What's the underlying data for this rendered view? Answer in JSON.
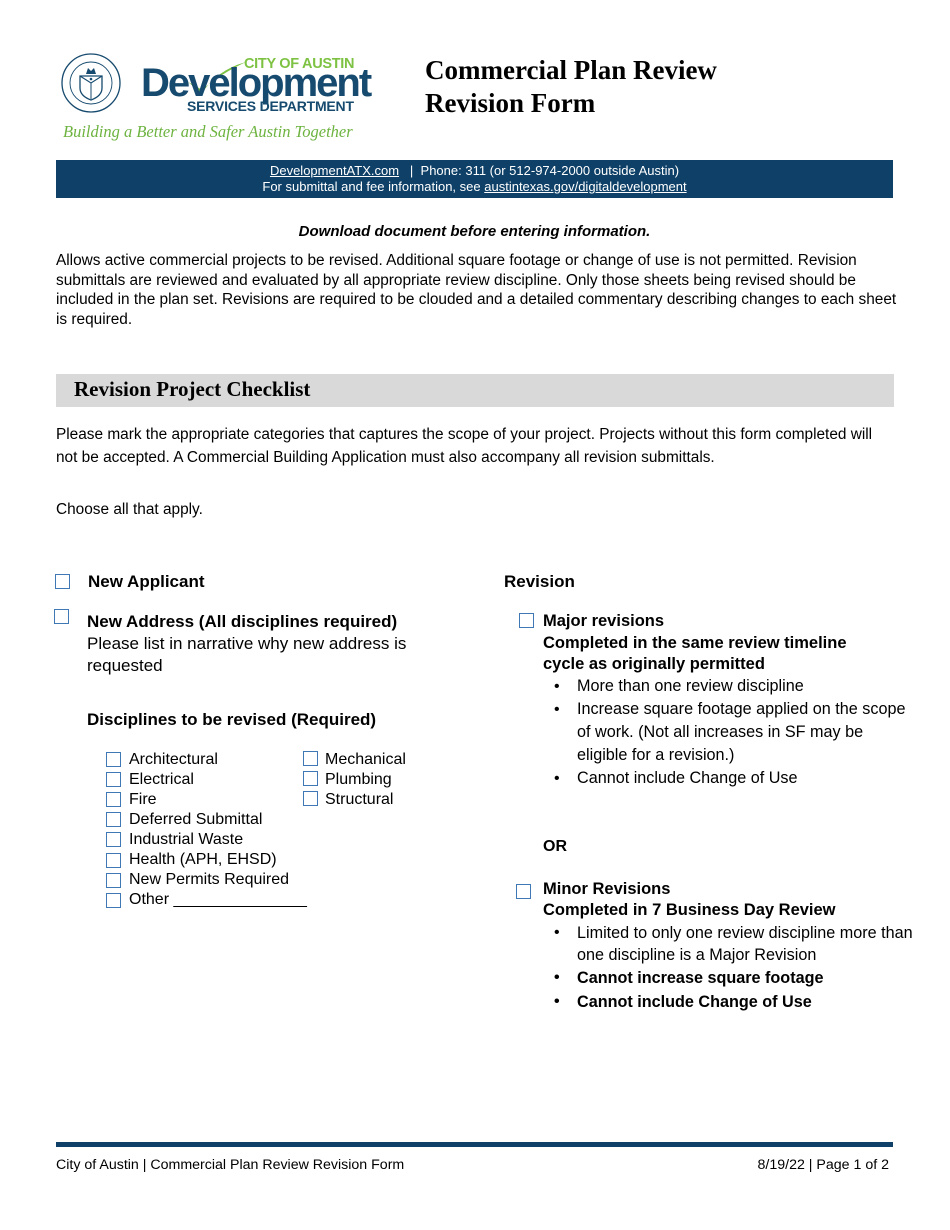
{
  "logo": {
    "seal_label": "City of Austin seal",
    "city_of_austin": "CITY OF AUSTIN",
    "development": "Development",
    "services_department": "SERVICES DEPARTMENT",
    "tagline": "Building a Better and Safer Austin Together",
    "colors": {
      "navy": "#164a6e",
      "green": "#7dc242"
    }
  },
  "header": {
    "title_line1": "Commercial Plan Review",
    "title_line2": "Revision Form"
  },
  "banner": {
    "website_link": "DevelopmentATX.com",
    "separator": "|",
    "phone": "Phone: 311 (or 512-974-2000 outside Austin)",
    "submittal_text": "For submittal and fee information, see",
    "submittal_link": "austintexas.gov/digitaldevelopment",
    "background": "#0e4068"
  },
  "download_note": "Download document before entering information.",
  "intro": "Allows active commercial projects to be revised. Additional square footage or change of use is not permitted. Revision submittals are reviewed and evaluated by all appropriate review discipline. Only those sheets being revised should be included in the plan set. Revisions are required to be clouded and a detailed commentary describing changes to each sheet is required.",
  "checklist": {
    "section_title": "Revision Project Checklist",
    "instructions": "Please mark the appropriate categories that captures the scope of your project. Projects without this form completed will not be accepted. A Commercial Building Application must also accompany all revision submittals.",
    "choose": "Choose all that apply.",
    "new_applicant": {
      "label": "New Applicant",
      "checked": false
    },
    "new_address": {
      "label": "New Address (All disciplines required)",
      "description": "Please list in narrative why new address is requested",
      "checked": false
    },
    "disciplines": {
      "heading": "Disciplines to be revised (Required)",
      "left": [
        {
          "label": "Architectural",
          "checked": false
        },
        {
          "label": "Electrical",
          "checked": false
        },
        {
          "label": "Fire",
          "checked": false
        },
        {
          "label": "Deferred Submittal",
          "checked": false
        },
        {
          "label": "Industrial Waste",
          "checked": false
        },
        {
          "label": "Health (APH, EHSD)",
          "checked": false
        },
        {
          "label": "New Permits Required",
          "checked": false
        },
        {
          "label": "Other _______________",
          "checked": false
        }
      ],
      "right": [
        {
          "label": "Mechanical",
          "checked": false
        },
        {
          "label": "Plumbing",
          "checked": false
        },
        {
          "label": "Structural",
          "checked": false
        }
      ]
    },
    "revision": {
      "heading": "Revision",
      "major": {
        "label": "Major revisions",
        "subtitle": "Completed in the same review timeline cycle as originally permitted",
        "checked": false,
        "bullets": [
          "More than one review discipline",
          "Increase square footage applied on the scope of work. (Not all increases in SF may be eligible for a revision.)",
          "Cannot include Change of Use"
        ]
      },
      "or": "OR",
      "minor": {
        "label": "Minor Revisions",
        "subtitle": "Completed in 7 Business Day Review",
        "checked": false,
        "bullets": [
          "Limited to only one review discipline more than one discipline is a Major Revision",
          "Cannot increase square footage",
          "Cannot include Change of Use"
        ]
      }
    }
  },
  "footer": {
    "left": "City of Austin | Commercial Plan Review Revision Form",
    "right": "8/19/22 | Page 1 of 2"
  }
}
